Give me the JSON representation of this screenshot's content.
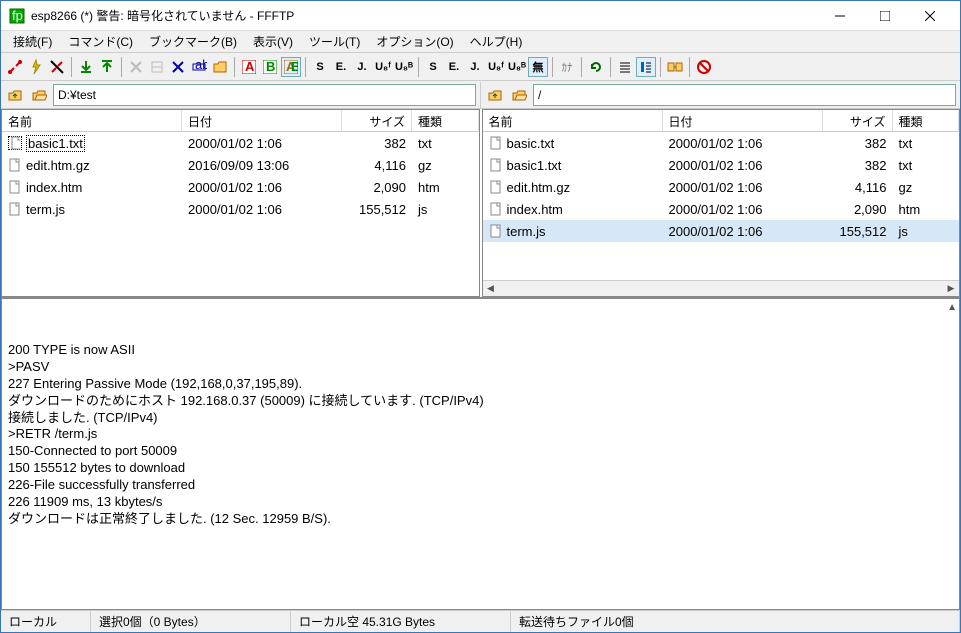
{
  "window": {
    "title": "esp8266 (*) 警告: 暗号化されていません - FFFTP"
  },
  "menu": {
    "connect": "接続(F)",
    "command": "コマンド(C)",
    "bookmark": "ブックマーク(B)",
    "view": "表示(V)",
    "tool": "ツール(T)",
    "option": "オプション(O)",
    "help": "ヘルプ(H)"
  },
  "path": {
    "local": "D:¥test",
    "remote": "/"
  },
  "columns": {
    "name": "名前",
    "date": "日付",
    "size": "サイズ",
    "type": "種類"
  },
  "local_files": [
    {
      "name": "basic1.txt",
      "date": "2000/01/02  1:06",
      "size": "382",
      "type": "txt",
      "focus": true
    },
    {
      "name": "edit.htm.gz",
      "date": "2016/09/09 13:06",
      "size": "4,116",
      "type": "gz"
    },
    {
      "name": "index.htm",
      "date": "2000/01/02  1:06",
      "size": "2,090",
      "type": "htm"
    },
    {
      "name": "term.js",
      "date": "2000/01/02  1:06",
      "size": "155,512",
      "type": "js"
    }
  ],
  "remote_files": [
    {
      "name": "basic.txt",
      "date": "2000/01/02  1:06",
      "size": "382",
      "type": "txt"
    },
    {
      "name": "basic1.txt",
      "date": "2000/01/02  1:06",
      "size": "382",
      "type": "txt"
    },
    {
      "name": "edit.htm.gz",
      "date": "2000/01/02  1:06",
      "size": "4,116",
      "type": "gz"
    },
    {
      "name": "index.htm",
      "date": "2000/01/02  1:06",
      "size": "2,090",
      "type": "htm"
    },
    {
      "name": "term.js",
      "date": "2000/01/02  1:06",
      "size": "155,512",
      "type": "js",
      "selected": true
    }
  ],
  "log_lines": [
    "200 TYPE is now ASII",
    ">PASV",
    "227 Entering Passive Mode (192,168,0,37,195,89).",
    "ダウンロードのためにホスト 192.168.0.37 (50009) に接続しています. (TCP/IPv4)",
    "接続しました. (TCP/IPv4)",
    ">RETR /term.js",
    "150-Connected to port 50009",
    "150 155512 bytes to download",
    "226-File successfully transferred",
    "226 11909 ms, 13 kbytes/s",
    "ダウンロードは正常終了しました. (12 Sec. 12959 B/S)."
  ],
  "status": {
    "local": "ローカル",
    "selection": "選択0個（0 Bytes）",
    "space": "ローカル空 45.31G Bytes",
    "queue": "転送待ちファイル0個"
  },
  "toolbar_codes": {
    "S1": "S",
    "E1": "E.",
    "J1": "J.",
    "U1": "U₈ᶠ",
    "U2": "U₈ᴮ",
    "S2": "S",
    "E2": "E.",
    "J2": "J.",
    "U3": "U₈ᶠ",
    "U4": "U₈ᴮ",
    "mu": "無"
  }
}
